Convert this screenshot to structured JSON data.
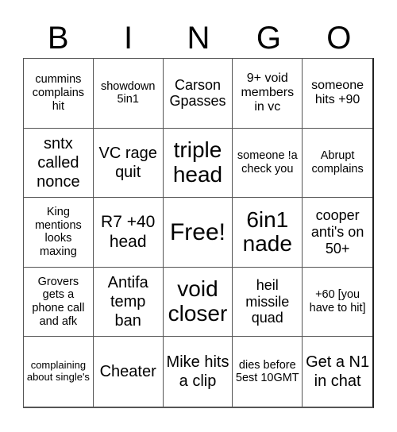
{
  "header": {
    "letters": [
      "B",
      "I",
      "N",
      "G",
      "O"
    ]
  },
  "cells": [
    "cummins complains hit",
    "showdown 5in1",
    "Carson Gpasses",
    "9+ void members in vc",
    "someone hits +90",
    "sntx called nonce",
    "VC rage quit",
    "triple head",
    "someone !a check you",
    "Abrupt complains",
    "King mentions looks maxing",
    "R7 +40 head",
    "Free!",
    "6in1 nade",
    "cooper anti's on 50+",
    "Grovers gets a phone call and afk",
    "Antifa temp ban",
    "void closer",
    "heil missile quad",
    "+60 [you have to hit]",
    "complaining about single's",
    "Cheater",
    "Mike hits a clip",
    "dies before 5est 10GMT",
    "Get a N1 in chat"
  ]
}
